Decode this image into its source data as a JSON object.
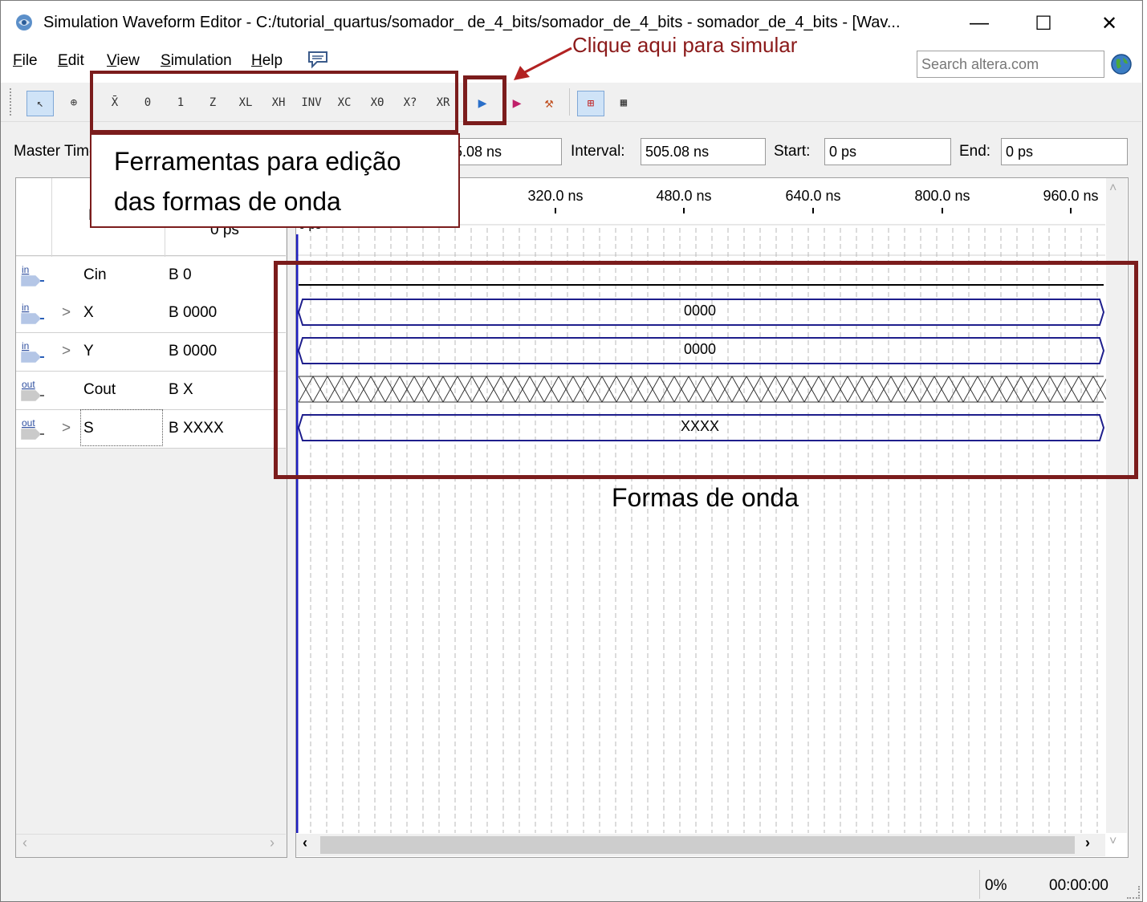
{
  "window": {
    "title": "Simulation Waveform Editor - C:/tutorial_quartus/somador_ de_4_bits/somador_de_4_bits - somador_de_4_bits - [Wav...",
    "controls": {
      "minimize": "—",
      "maximize": "☐",
      "close": "✕"
    }
  },
  "menu": {
    "file": {
      "first": "F",
      "rest": "ile"
    },
    "edit": {
      "first": "E",
      "rest": "dit"
    },
    "view": {
      "first": "V",
      "rest": "iew"
    },
    "simulation": {
      "first": "S",
      "rest": "imulation"
    },
    "help": {
      "first": "H",
      "rest": "elp"
    }
  },
  "search": {
    "placeholder": "Search altera.com"
  },
  "toolbar": {
    "icons": {
      "select": "↖",
      "zoom": "⊕",
      "unknown": "X̄",
      "force_low": "0",
      "force_high": "1",
      "high_z": "Z",
      "weak_low": "XL",
      "weak_high": "XH",
      "invert": "INV",
      "count": "XC",
      "clock": "XΘ",
      "arbitrary": "X?",
      "random": "XR",
      "run_functional": "▶",
      "run_timing": "▶",
      "generate_netlist": "⚒",
      "snap": "⊞",
      "grid": "▦"
    }
  },
  "timing": {
    "master_time_label": "Master Time",
    "master_time_value": "5.08 ns",
    "interval_label": "Interval:",
    "interval_value": "505.08 ns",
    "start_label": "Start:",
    "start_value": "0 ps",
    "end_label": "End:",
    "end_value": "0 ps"
  },
  "columns": {
    "name": "N",
    "value_at": "0 ps"
  },
  "time_ruler": {
    "ticks": [
      "320.0 ns",
      "480.0 ns",
      "640.0 ns",
      "800.0 ns",
      "960.0 ns"
    ],
    "cursor_label": "0 ps"
  },
  "signals": [
    {
      "dir": "in",
      "expand": "",
      "name": "Cin",
      "value": "B 0",
      "wave": "0"
    },
    {
      "dir": "in",
      "expand": ">",
      "name": "X",
      "value": "B 0000",
      "wave": "0000"
    },
    {
      "dir": "in",
      "expand": ">",
      "name": "Y",
      "value": "B 0000",
      "wave": "0000"
    },
    {
      "dir": "out",
      "expand": "",
      "name": "Cout",
      "value": "B X",
      "wave": "X"
    },
    {
      "dir": "out",
      "expand": ">",
      "name": "S",
      "value": "B XXXX",
      "wave": "XXXX"
    }
  ],
  "status": {
    "progress": "0%",
    "elapsed": "00:00:00"
  },
  "annotations": {
    "simulate": "Clique aqui para simular",
    "tools_line1": "Ferramentas para edição",
    "tools_line2": "das formas de onda",
    "waveforms": "Formas de onda"
  },
  "colors": {
    "annotation": "#8b1a1a",
    "bus": "#1e1e8c",
    "cursor": "#2020c0"
  }
}
